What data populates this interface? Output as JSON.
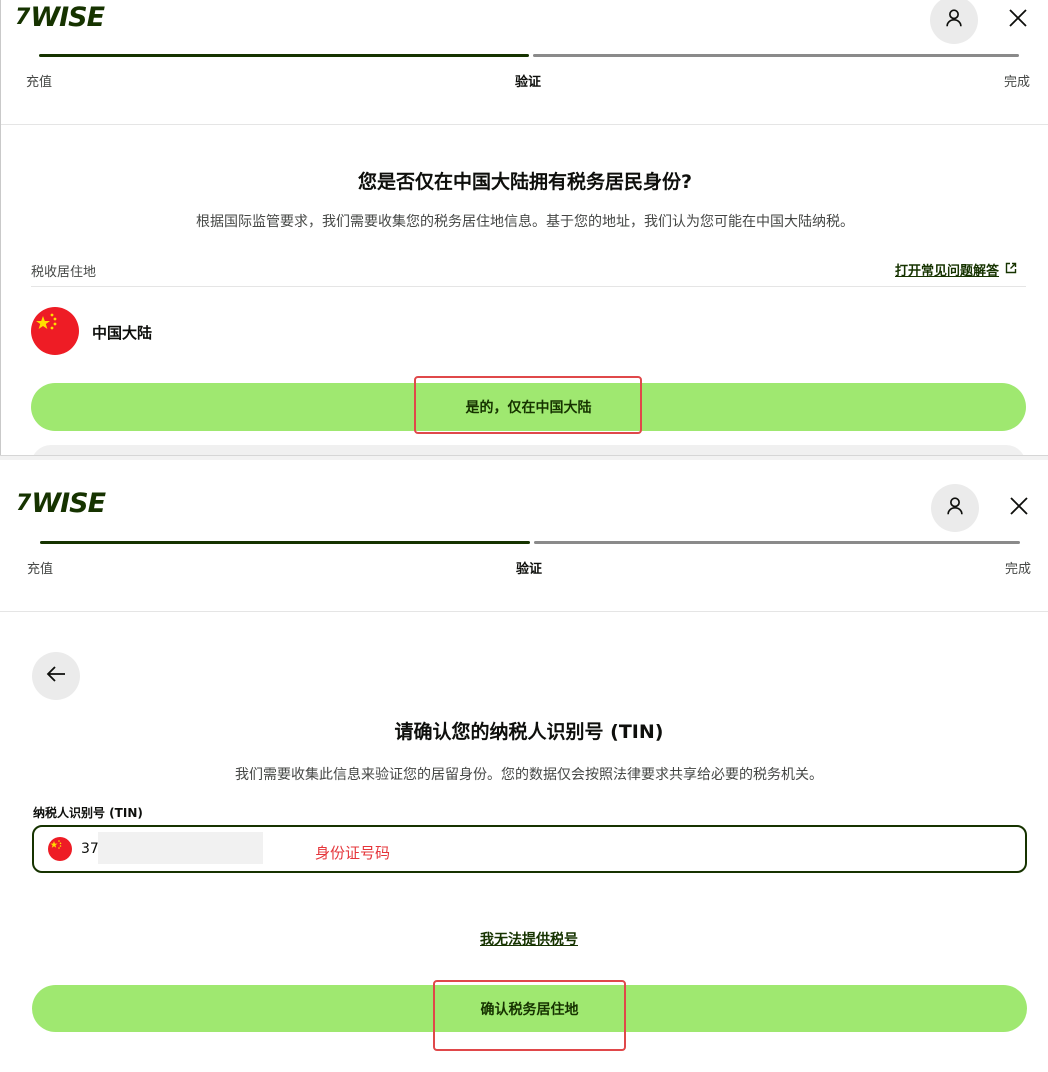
{
  "brand": {
    "name": "WISE",
    "mark": "7",
    "color": "#163300",
    "accent": "#9fe870"
  },
  "header": {
    "avatar_icon": "person-icon",
    "close_icon": "close-icon",
    "steps": [
      "充值",
      "验证",
      "完成"
    ],
    "active_step_index": 1,
    "progress_fraction": 0.5
  },
  "screen1": {
    "title": "您是否仅在中国大陆拥有税务居民身份?",
    "subtitle": "根据国际监管要求，我们需要收集您的税务居住地信息。基于您的地址，我们认为您可能在中国大陆纳税。",
    "residence_label": "税收居住地",
    "faq_link": "打开常见问题解答",
    "faq_icon": "external-link-icon",
    "country": "中国大陆",
    "flag_icon": "china-flag-icon",
    "confirm_button": "是的，仅在中国大陆"
  },
  "screen2": {
    "back_icon": "arrow-left-icon",
    "title": "请确认您的纳税人识别号 (TIN)",
    "subtitle": "我们需要收集此信息来验证您的居留身份。您的数据仅会按照法律要求共享给必要的税务机关。",
    "field_label": "纳税人识别号 (TIN)",
    "field_value": "37",
    "annotation": "身份证号码",
    "no_tin_link": "我无法提供税号",
    "confirm_button": "确认税务居住地"
  },
  "colors": {
    "highlight": "#e0484a",
    "annotation": "#e5353a"
  }
}
